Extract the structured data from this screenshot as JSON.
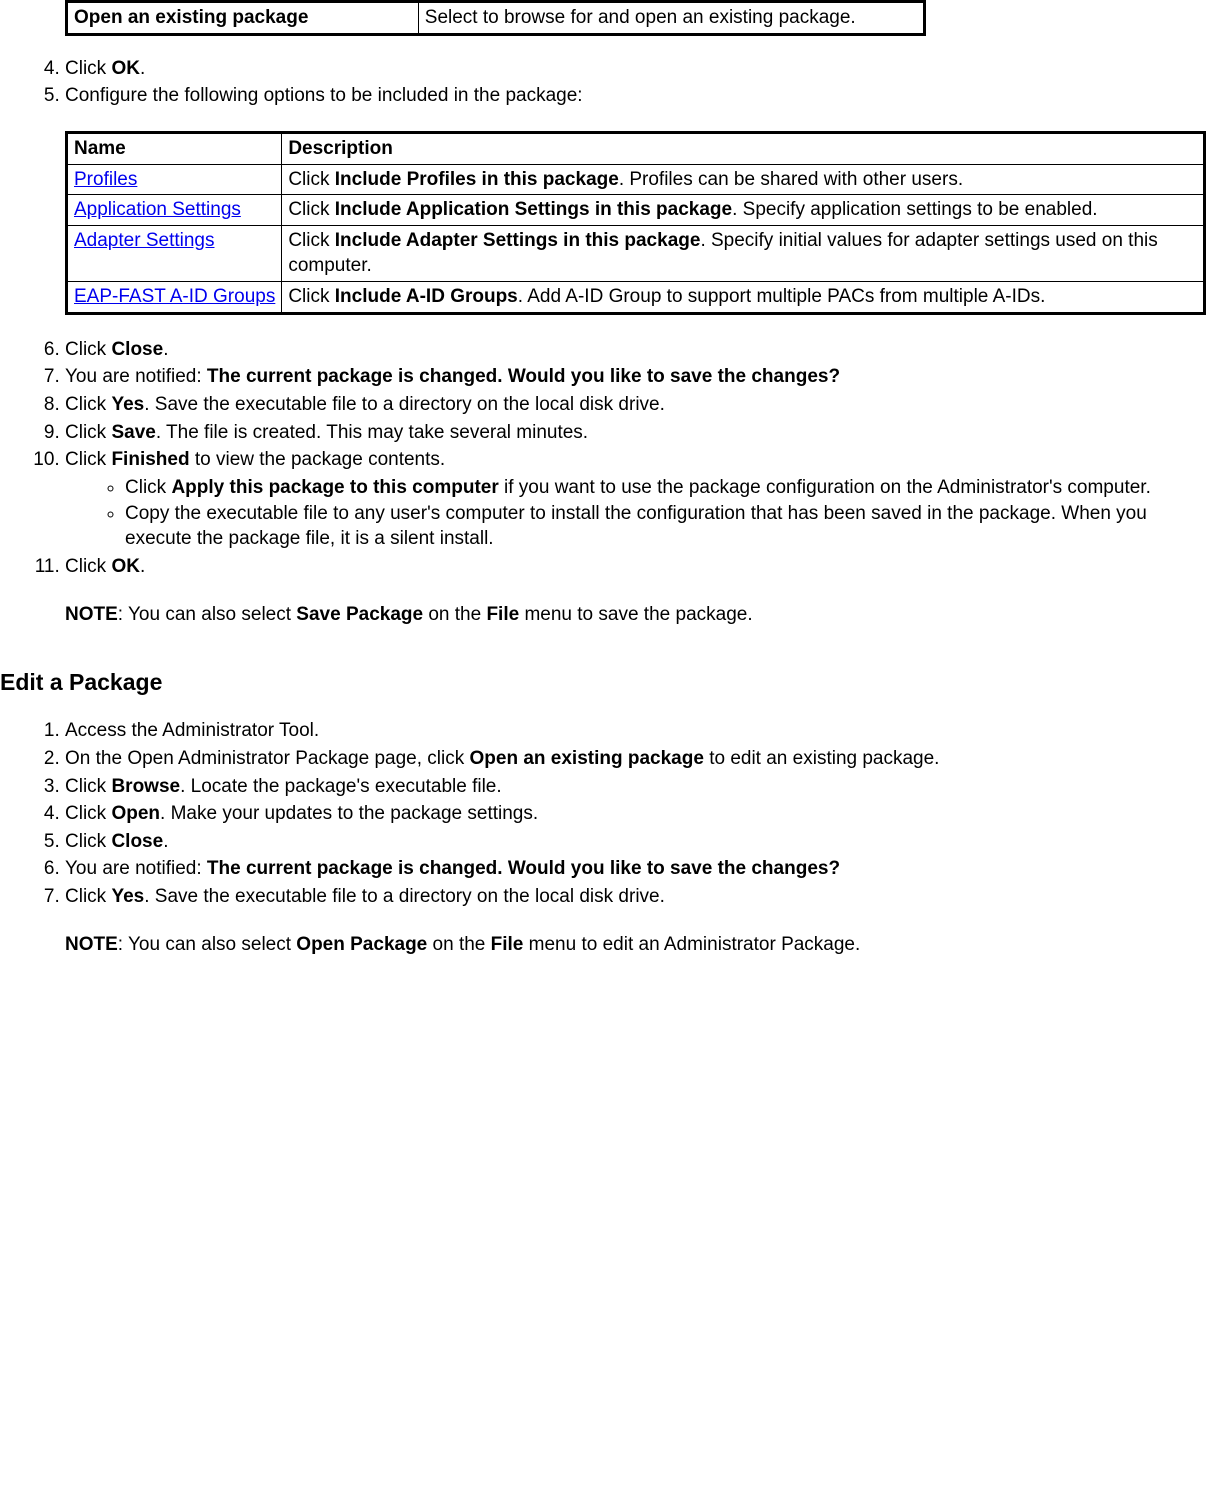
{
  "topTable": {
    "left": "Open an existing package",
    "right": "Select to browse for and open an existing package."
  },
  "steps1": {
    "s4_a": "Click ",
    "s4_b": "OK",
    "s4_c": ".",
    "s5": "Configure the following options to be included in the package:"
  },
  "optionsTable": {
    "hName": "Name",
    "hDesc": "Description",
    "rows": [
      {
        "link": "Profiles",
        "d1": "Click ",
        "d2": "Include Profiles in this package",
        "d3": ". Profiles can be shared with other users."
      },
      {
        "link": "Application Settings",
        "d1": "Click ",
        "d2": "Include Application Settings in this package",
        "d3": ". Specify application settings to be enabled."
      },
      {
        "link": "Adapter Settings",
        "d1": "Click ",
        "d2": "Include Adapter Settings in this package",
        "d3": ". Specify initial values for adapter settings used on this computer."
      },
      {
        "link": "EAP-FAST A-ID Groups",
        "d1": "Click ",
        "d2": "Include A-ID Groups",
        "d3": ". Add A-ID Group to support multiple PACs from multiple A-IDs."
      }
    ]
  },
  "steps2": {
    "s6_a": "Click ",
    "s6_b": "Close",
    "s6_c": ".",
    "s7_a": "You are notified: ",
    "s7_b": "The current package is changed. Would you like to save the changes?",
    "s8_a": "Click ",
    "s8_b": "Yes",
    "s8_c": ". Save the executable file to a directory on the local disk drive.",
    "s9_a": "Click ",
    "s9_b": "Save",
    "s9_c": ". The file is created. This may take several minutes.",
    "s10_a": "Click ",
    "s10_b": "Finished",
    "s10_c": " to view the package contents.",
    "s10_sub1_a": "Click ",
    "s10_sub1_b": "Apply this package to this computer",
    "s10_sub1_c": " if you want to use the package configuration on the Administrator's computer.",
    "s10_sub2": "Copy the executable file to any user's computer to install the configuration that has been saved in the package. When you execute the package file, it is a silent install.",
    "s11_a": "Click ",
    "s11_b": "OK",
    "s11_c": ".",
    "note1_a": "NOTE",
    "note1_b": ": You can also select ",
    "note1_c": "Save Package",
    "note1_d": " on the ",
    "note1_e": "File",
    "note1_f": " menu to save the package."
  },
  "editHeading": "Edit a Package",
  "editSteps": {
    "e1": "Access the Administrator Tool.",
    "e2_a": "On the Open Administrator Package page, click ",
    "e2_b": "Open an existing package",
    "e2_c": " to edit an existing package.",
    "e3_a": "Click ",
    "e3_b": "Browse",
    "e3_c": ". Locate the package's executable file.",
    "e4_a": "Click ",
    "e4_b": "Open",
    "e4_c": ". Make your updates to the package settings.",
    "e5_a": "Click ",
    "e5_b": "Close",
    "e5_c": ".",
    "e6_a": "You are notified: ",
    "e6_b": "The current package is changed. Would you like to save the changes?",
    "e7_a": "Click ",
    "e7_b": "Yes",
    "e7_c": ". Save the executable file to a directory on the local disk drive.",
    "note2_a": "NOTE",
    "note2_b": ": You can also select ",
    "note2_c": "Open Package",
    "note2_d": " on the ",
    "note2_e": "File",
    "note2_f": " menu to edit an Administrator Package."
  }
}
